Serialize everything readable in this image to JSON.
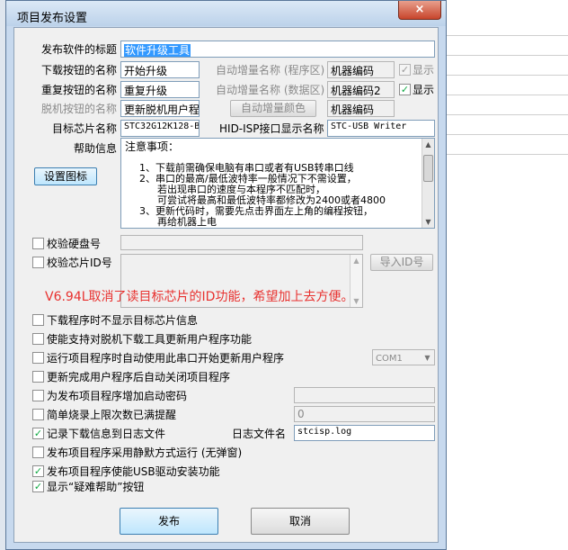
{
  "window": {
    "title": "项目发布设置",
    "close_label": "×"
  },
  "form": {
    "title_label": "发布软件的标题",
    "title_value": "软件升级工具",
    "download_btn_label": "下载按钮的名称",
    "download_btn_value": "开始升级",
    "repeat_btn_label": "重复按钮的名称",
    "repeat_btn_value": "重复升级",
    "offline_btn_label": "脱机按钮的名称",
    "offline_btn_value": "更新脱机用户程",
    "auto_inc_prog_label": "自动增量名称 (程序区)",
    "auto_inc_prog_value": "机器编码",
    "auto_inc_data_label": "自动增量名称 (数据区)",
    "auto_inc_data_value": "机器编码2",
    "auto_inc_color_label": "自动增量颜色",
    "auto_inc_color_value": "机器编码",
    "show_label": "显示",
    "chip_label": "目标芯片名称",
    "chip_value": "STC32G12K128-B",
    "isp_label": "HID-ISP接口显示名称",
    "isp_value": "STC-USB Writer",
    "help_label": "帮助信息",
    "set_icon_label": "设置图标",
    "help_lines": [
      "注意事项：",
      "1、下载前需确保电脑有串口或者有USB转串口线",
      "2、串口的最高/最低波特率一般情况下不需设置，",
      "若出现串口的速度与本程序不匹配时，",
      "可尝试将最高和最低波特率都修改为2400或者4800",
      "3、更新代码时，需要先点击界面左上角的编程按钮，",
      "再给机器上电"
    ],
    "verify_disk_label": "校验硬盘号",
    "verify_chip_label": "校验芯片ID号",
    "import_id_label": "导入ID号",
    "note": "V6.94L取消了读目标芯片的ID功能，希望加上去方便。",
    "opt_no_chip_info": "下载程序时不显示目标芯片信息",
    "opt_offline_tool": "使能支持对脱机下载工具更新用户程序功能",
    "opt_auto_serial": "运行项目程序时自动使用此串口开始更新用户程序",
    "com_value": "COM1",
    "opt_auto_close": "更新完成用户程序后自动关闭项目程序",
    "opt_password": "为发布项目程序增加启动密码",
    "opt_limit": "简单烧录上限次数已满提醒",
    "limit_value": "0",
    "opt_log": "记录下载信息到日志文件",
    "log_file_label": "日志文件名",
    "log_file_value": "stcisp.log",
    "opt_silent": "发布项目程序采用静默方式运行 (无弹窗)",
    "opt_usb": "发布项目程序使能USB驱动安装功能",
    "opt_help": "显示“疑难帮助”按钮",
    "publish_label": "发布",
    "cancel_label": "取消"
  }
}
